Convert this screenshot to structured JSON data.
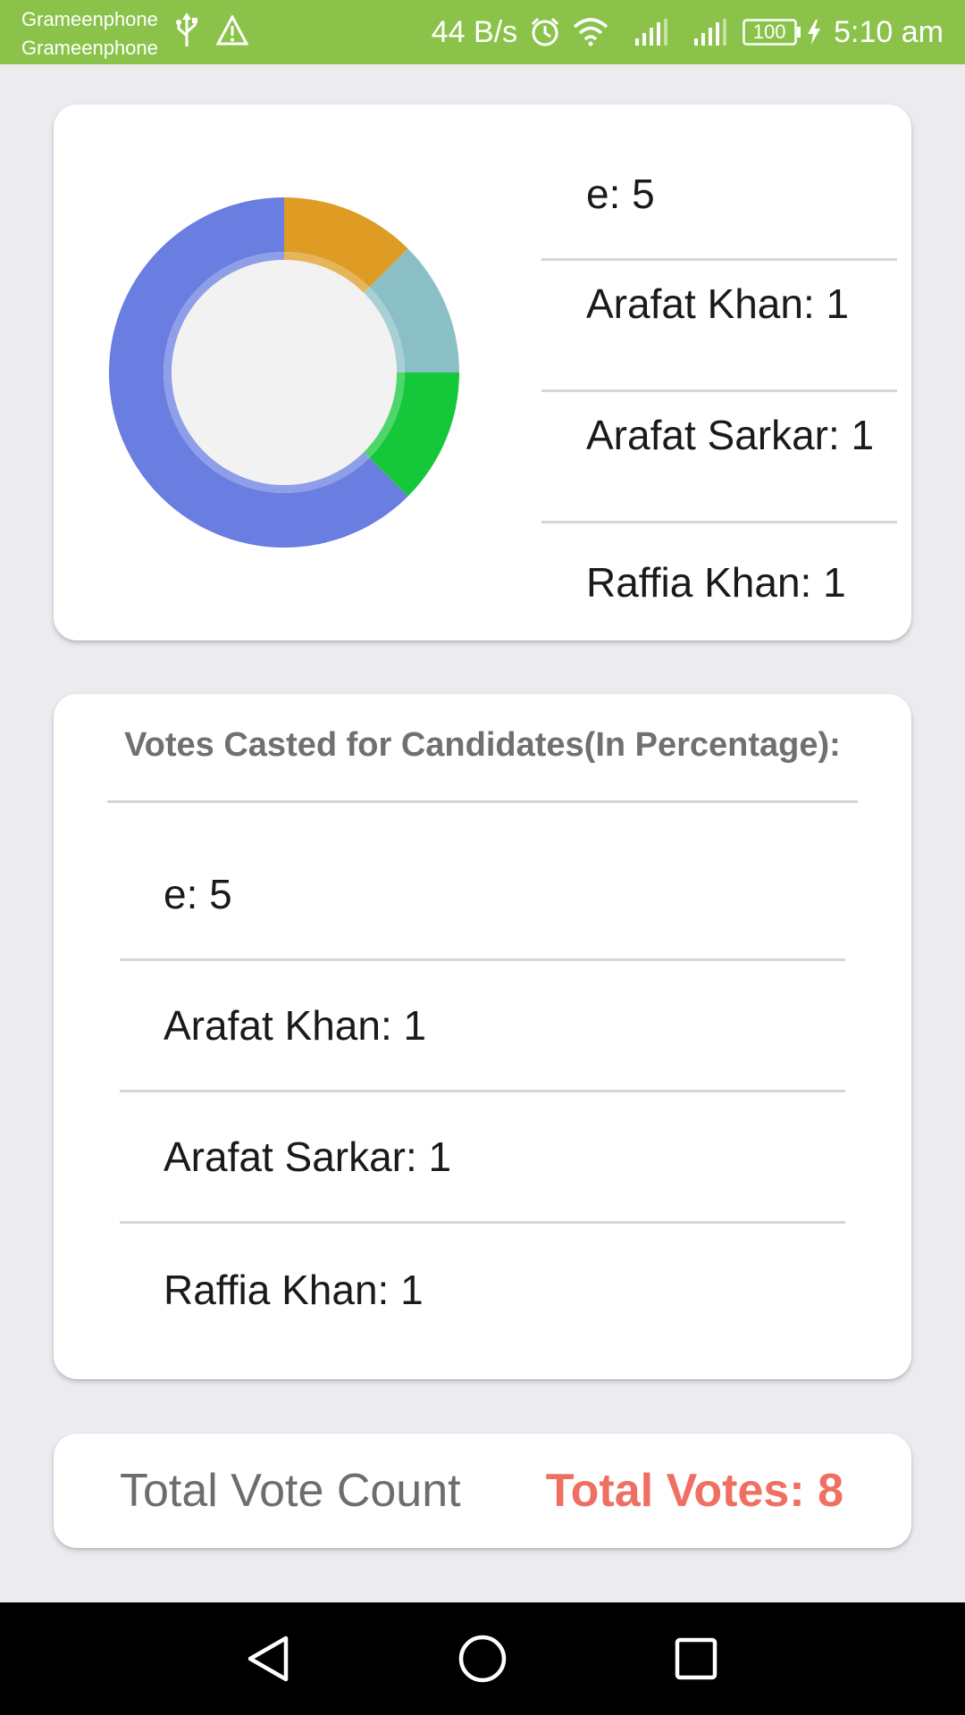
{
  "status_bar": {
    "carriers": [
      "Grameenphone",
      "Grameenphone"
    ],
    "net_speed": "44 B/s",
    "battery": "100",
    "time": "5:10 am",
    "icons": [
      "usb-icon",
      "warning-icon",
      "alarm-icon",
      "wifi-icon",
      "signal-icon",
      "signal-icon",
      "battery-icon",
      "charging-icon"
    ]
  },
  "chart_card": {
    "legend": [
      {
        "label": "e: 5"
      },
      {
        "label": "Arafat Khan: 1"
      },
      {
        "label": "Arafat Sarkar: 1"
      },
      {
        "label": "Raffia Khan: 1"
      }
    ]
  },
  "chart_data": {
    "type": "pie",
    "donut": true,
    "categories": [
      "e",
      "Arafat Khan",
      "Arafat Sarkar",
      "Raffia Khan"
    ],
    "values": [
      5,
      1,
      1,
      1
    ],
    "colors": [
      "#6a7de0",
      "#de9c24",
      "#8bbfc6",
      "#14c83a"
    ],
    "title": ""
  },
  "votes_card": {
    "title": "Votes Casted for Candidates(In Percentage):",
    "rows": [
      "e: 5",
      "Arafat Khan: 1",
      "Arafat Sarkar: 1",
      "Raffia Khan: 1"
    ]
  },
  "total_card": {
    "label": "Total Vote Count",
    "value": "Total Votes: 8",
    "value_color": "#ef6f63"
  },
  "nav_bar": {
    "buttons": [
      "back-icon",
      "home-icon",
      "recents-icon"
    ]
  }
}
